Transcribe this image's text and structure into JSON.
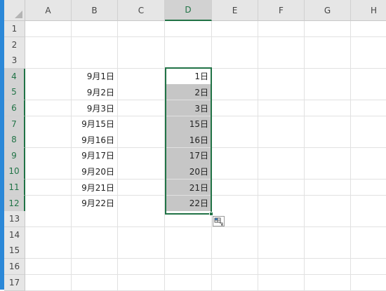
{
  "columns": [
    "A",
    "B",
    "C",
    "D",
    "E",
    "F",
    "G",
    "H"
  ],
  "rows": [
    "1",
    "2",
    "3",
    "4",
    "5",
    "6",
    "7",
    "8",
    "9",
    "10",
    "11",
    "12",
    "13",
    "14",
    "15",
    "16",
    "17"
  ],
  "column_b": [
    "9月1日",
    "9月2日",
    "9月3日",
    "9月15日",
    "9月16日",
    "9月17日",
    "9月20日",
    "9月21日",
    "9月22日"
  ],
  "column_d": [
    "1日",
    "2日",
    "3日",
    "15日",
    "16日",
    "17日",
    "20日",
    "21日",
    "22日"
  ],
  "selected_column": "D",
  "selected_rows": [
    "4",
    "5",
    "6",
    "7",
    "8",
    "9",
    "10",
    "11",
    "12"
  ],
  "icons": {
    "select_all": "select-all-triangle-icon",
    "autofill": "autofill-options-icon"
  },
  "colors": {
    "accent": "#217346",
    "selection_fill": "#c6c6c6",
    "header_bg": "#e6e6e6",
    "left_bar": "#2b88d8"
  }
}
